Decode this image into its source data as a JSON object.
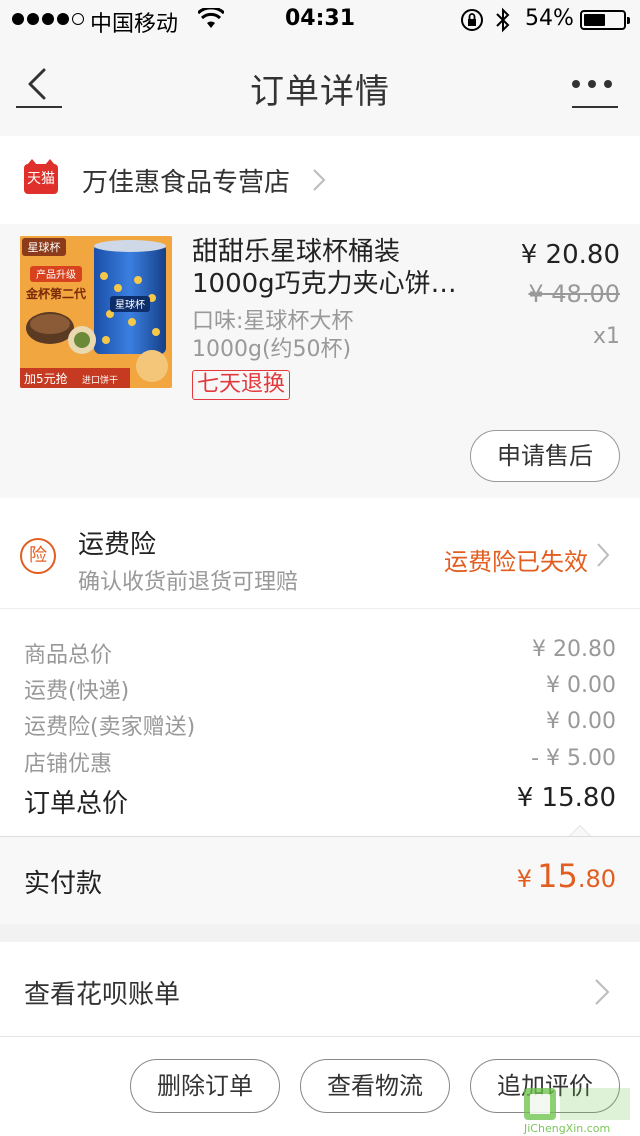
{
  "status_bar": {
    "carrier": "中国移动",
    "time": "04:31",
    "battery_percent": "54%",
    "battery_level": 0.54
  },
  "nav": {
    "title": "订单详情"
  },
  "store": {
    "badge": "天猫",
    "name": "万佳惠食品专营店"
  },
  "product": {
    "title_line1": "甜甜乐星球杯桶装",
    "title_line2": "1000g巧克力夹心饼…",
    "spec_line1": "口味:星球杯大杯",
    "spec_line2": "1000g(约50杯)",
    "tag": "七天退换",
    "price": "¥ 20.80",
    "original_price": "¥ 48.00",
    "quantity": "x1",
    "after_sale_button": "申请售后"
  },
  "insurance": {
    "icon_char": "险",
    "title": "运费险",
    "description": "确认收货前退货可理赔",
    "status": "运费险已失效"
  },
  "breakdown": [
    {
      "label": "商品总价",
      "value": "¥ 20.80"
    },
    {
      "label": "运费(快递)",
      "value": "¥ 0.00"
    },
    {
      "label": "运费险(卖家赠送)",
      "value": "¥ 0.00"
    },
    {
      "label": "店铺优惠",
      "value": "- ¥ 5.00"
    },
    {
      "label": "订单总价",
      "value": "¥ 15.80"
    }
  ],
  "paid": {
    "label": "实付款",
    "currency": "¥",
    "integer": "15",
    "decimal": ".80"
  },
  "huabei": {
    "label": "查看花呗账单"
  },
  "actions": {
    "delete": "删除订单",
    "logistics": "查看物流",
    "review": "追加评价"
  },
  "product_image": {
    "brand": "星球杯",
    "upgrade": "产品升级",
    "gen": "金杯第二代",
    "promo": "加5元抢",
    "promo2": "进口饼干"
  },
  "watermark": {
    "text": "JiChengXin.com"
  },
  "colors": {
    "accent_orange": "#e25e20",
    "tmall_red": "#e0302b",
    "tag_red": "#e4393c"
  }
}
